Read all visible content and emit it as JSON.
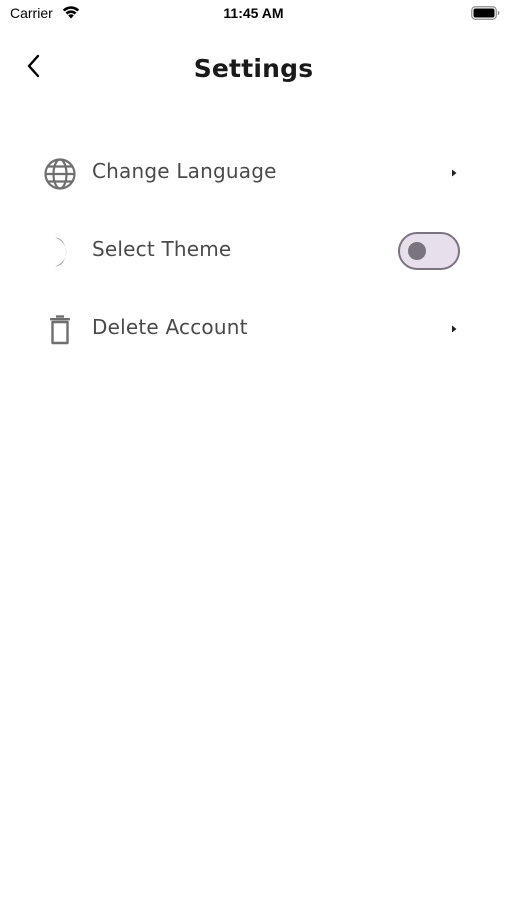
{
  "status_bar": {
    "carrier": "Carrier",
    "time": "11:45 AM",
    "wifi_icon": "wifi-icon",
    "battery_icon": "battery-icon"
  },
  "header": {
    "title": "Settings",
    "back_icon": "chevron-left-icon"
  },
  "settings": {
    "items": [
      {
        "label": "Change Language",
        "icon": "globe-icon",
        "trailing": "chevron-right-icon"
      },
      {
        "label": "Select Theme",
        "icon": "moon-icon",
        "trailing": "toggle",
        "toggle_on": false
      },
      {
        "label": "Delete Account",
        "icon": "trash-icon",
        "trailing": "chevron-right-icon"
      }
    ]
  },
  "colors": {
    "icon": "#6f6f6f",
    "label": "#4a4a4a",
    "toggle_track": "#e7e0ec",
    "toggle_border": "#7a7480",
    "toggle_knob": "#79747e"
  }
}
